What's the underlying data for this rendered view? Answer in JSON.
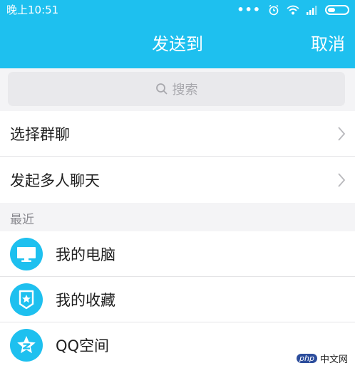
{
  "status": {
    "time": "晚上10:51"
  },
  "header": {
    "title": "发送到",
    "cancel_label": "取消"
  },
  "search": {
    "placeholder": "搜索"
  },
  "menu": [
    {
      "label": "选择群聊"
    },
    {
      "label": "发起多人聊天"
    }
  ],
  "recent": {
    "section_label": "最近",
    "items": [
      {
        "label": "我的电脑",
        "icon": "computer-icon"
      },
      {
        "label": "我的收藏",
        "icon": "favorites-icon"
      },
      {
        "label": "QQ空间",
        "icon": "qzone-icon"
      }
    ]
  },
  "watermark": {
    "badge": "php",
    "text": "中文网"
  },
  "colors": {
    "accent": "#1ec0ef",
    "background": "#f4f4f6"
  }
}
